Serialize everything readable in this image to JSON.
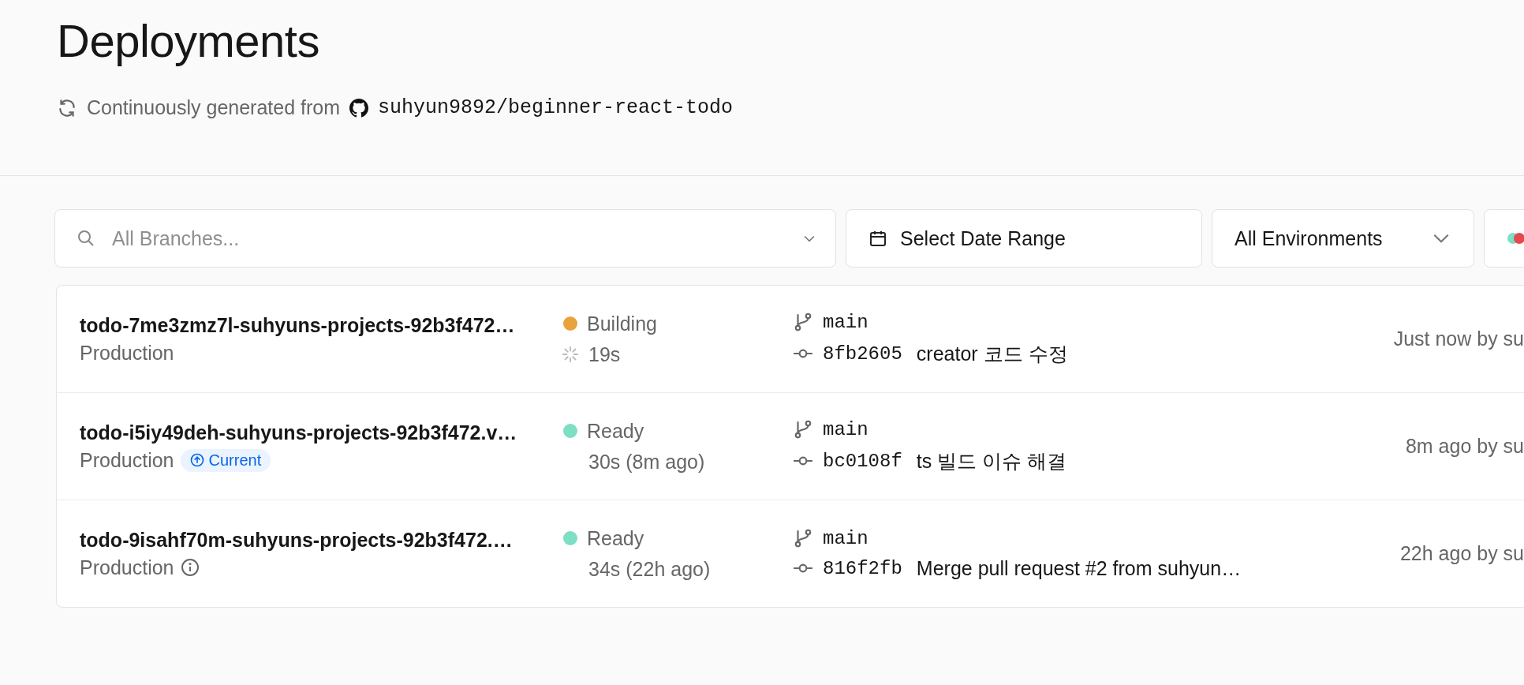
{
  "page": {
    "title": "Deployments",
    "source_label": "Continuously generated from",
    "repository": "suhyun9892/beginner-react-todo"
  },
  "filters": {
    "branch_search": {
      "placeholder": "All Branches..."
    },
    "date_range": {
      "label": "Select Date Range"
    },
    "environment": {
      "label": "All Environments"
    }
  },
  "deployments": [
    {
      "name": "todo-7me3zmz7l-suhyuns-projects-92b3f472…",
      "environment": "Production",
      "info": false,
      "status": "Building",
      "color": "#e8a33d",
      "spinner": true,
      "duration": "19s",
      "branch": "main",
      "commit": "8fb2605",
      "message": "creator 코드 수정",
      "time": "Just now by su"
    },
    {
      "name": "todo-i5iy49deh-suhyuns-projects-92b3f472.v…",
      "environment": "Production",
      "info": false,
      "badge": "Current",
      "status": "Ready",
      "color": "#7ddfc3",
      "spinner": false,
      "duration": "30s (8m ago)",
      "branch": "main",
      "commit": "bc0108f",
      "message": "ts 빌드 이슈 해결",
      "time": "8m ago by su"
    },
    {
      "name": "todo-9isahf70m-suhyuns-projects-92b3f472.…",
      "environment": "Production",
      "info": true,
      "status": "Ready",
      "color": "#7ddfc3",
      "spinner": false,
      "duration": "34s (22h ago)",
      "branch": "main",
      "commit": "816f2fb",
      "message": "Merge pull request #2 from suhyun…",
      "time": "22h ago by su"
    }
  ]
}
